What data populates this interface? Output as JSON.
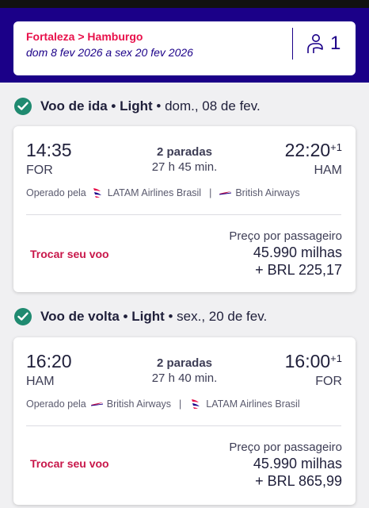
{
  "search": {
    "route": "Fortaleza > Hamburgo",
    "dates": "dom 8 fev 2026 a sex 20 fev 2026",
    "passengers": "1",
    "passenger_icon": "person-icon"
  },
  "outbound": {
    "section_label": "Voo de ida",
    "fare": "Light",
    "date": "dom., 08 de fev.",
    "depart_time": "14:35",
    "arrive_time": "22:20",
    "day_offset": "+1",
    "origin": "FOR",
    "destination": "HAM",
    "stops": "2 paradas",
    "duration": "27 h 45 min.",
    "operated_label": "Operado pela",
    "airline_1": "LATAM Airlines Brasil",
    "airline_2": "British Airways",
    "change_label": "Trocar seu voo",
    "price_label": "Preço por passageiro",
    "price_miles": "45.990 milhas",
    "price_brl": "+ BRL 225,17"
  },
  "inbound": {
    "section_label": "Voo de volta",
    "fare": "Light",
    "date": "sex., 20 de fev.",
    "depart_time": "16:20",
    "arrive_time": "16:00",
    "day_offset": "+1",
    "origin": "HAM",
    "destination": "FOR",
    "stops": "2 paradas",
    "duration": "27 h 40 min.",
    "operated_label": "Operado pela",
    "airline_1": "British Airways",
    "airline_2": "LATAM Airlines Brasil",
    "change_label": "Trocar seu voo",
    "price_label": "Preço por passageiro",
    "price_miles": "45.990 milhas",
    "price_brl": "+ BRL 865,99"
  },
  "colors": {
    "header": "#1b0088",
    "accent": "#e8114b",
    "check": "#1f8a70",
    "link": "#c8174a"
  }
}
